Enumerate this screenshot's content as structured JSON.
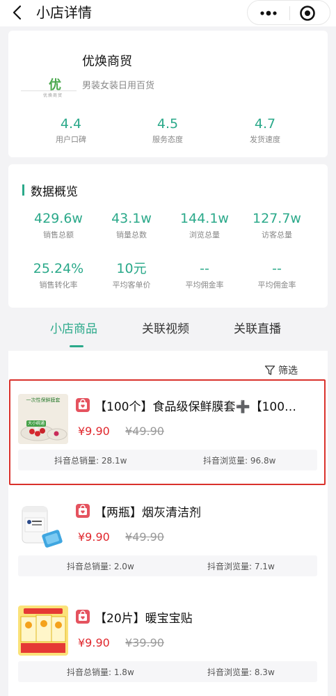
{
  "nav": {
    "title": "小店详情"
  },
  "shop": {
    "logo_text": "优",
    "logo_sub": "优焕商贸",
    "name": "优焕商贸",
    "category": "男装女装日用百货",
    "ratings": [
      {
        "value": "4.4",
        "label": "用户口碑"
      },
      {
        "value": "4.5",
        "label": "服务态度"
      },
      {
        "value": "4.7",
        "label": "发货速度"
      }
    ]
  },
  "overview": {
    "title": "数据概览",
    "stats": [
      {
        "value": "429.6w",
        "label": "销售总额"
      },
      {
        "value": "43.1w",
        "label": "销量总数"
      },
      {
        "value": "144.1w",
        "label": "浏览总量"
      },
      {
        "value": "127.7w",
        "label": "访客总量"
      },
      {
        "value": "25.24%",
        "label": "销售转化率"
      },
      {
        "value": "10元",
        "label": "平均客单价"
      },
      {
        "value": "--",
        "label": "平均佣金率"
      },
      {
        "value": "--",
        "label": "平均佣金率"
      }
    ]
  },
  "tabs": [
    {
      "label": "小店商品",
      "active": true
    },
    {
      "label": "关联视频",
      "active": false
    },
    {
      "label": "关联直播",
      "active": false
    }
  ],
  "filter_label": "筛选",
  "products": [
    {
      "title": "【100个】食品级保鲜膜套➕【100…",
      "price": "¥9.90",
      "original_price": "¥49.90",
      "sales": "抖音总销量: 28.1w",
      "views": "抖音浏览量: 96.8w",
      "thumb_text_top": "一次性保鲜膜套",
      "thumb_text_tag": "大小碗通用"
    },
    {
      "title": "【两瓶】烟灰清洁剂",
      "price": "¥9.90",
      "original_price": "¥49.90",
      "sales": "抖音总销量: 2.0w",
      "views": "抖音浏览量: 7.1w"
    },
    {
      "title": "【20片】暖宝宝贴",
      "price": "¥9.90",
      "original_price": "¥39.90",
      "sales": "抖音总销量: 1.8w",
      "views": "抖音浏览量: 8.3w"
    }
  ],
  "colors": {
    "accent": "#2ba98a",
    "price": "#e0282e",
    "highlight": "#d9312b"
  }
}
